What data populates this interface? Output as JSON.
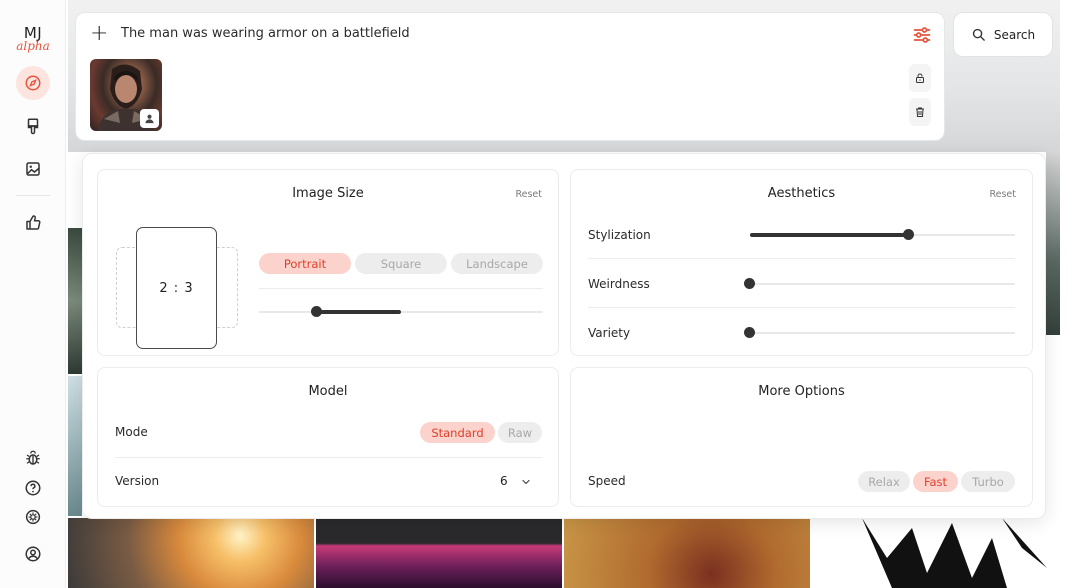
{
  "app": {
    "logo_top": "MJ",
    "logo_bottom": "alpha",
    "accent": "#e8543e"
  },
  "sidebar": {
    "items": [
      {
        "name": "explore",
        "icon": "compass-icon",
        "active": true
      },
      {
        "name": "create",
        "icon": "paintbrush-icon"
      },
      {
        "name": "organize",
        "icon": "image-icon"
      },
      {
        "name": "rate",
        "icon": "thumbs-up-icon"
      }
    ],
    "bottom": [
      {
        "name": "bug-report",
        "icon": "bug-icon"
      },
      {
        "name": "help",
        "icon": "help-icon"
      },
      {
        "name": "theme",
        "icon": "sun-icon"
      },
      {
        "name": "account",
        "icon": "user-circle-icon"
      }
    ]
  },
  "prompt": {
    "text": "The man was wearing armor on a battlefield",
    "add_icon": "plus-icon",
    "settings_icon": "sliders-icon"
  },
  "search": {
    "label": "Search"
  },
  "image_size": {
    "title": "Image Size",
    "reset": "Reset",
    "ratio": "2 : 3",
    "options": [
      "Portrait",
      "Square",
      "Landscape"
    ],
    "selected": "Portrait"
  },
  "aesthetics": {
    "title": "Aesthetics",
    "reset": "Reset",
    "sliders": [
      {
        "label": "Stylization",
        "value": 0.6
      },
      {
        "label": "Weirdness",
        "value": 0
      },
      {
        "label": "Variety",
        "value": 0
      }
    ]
  },
  "model": {
    "title": "Model",
    "mode_label": "Mode",
    "modes": [
      "Standard",
      "Raw"
    ],
    "mode_selected": "Standard",
    "version_label": "Version",
    "version_value": "6"
  },
  "more_options": {
    "title": "More Options",
    "speed_label": "Speed",
    "speeds": [
      "Relax",
      "Fast",
      "Turbo"
    ],
    "speed_selected": "Fast"
  }
}
